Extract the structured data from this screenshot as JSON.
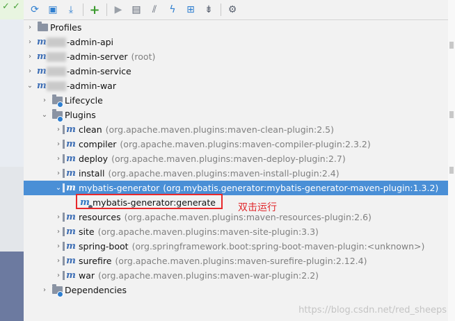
{
  "toolbar": {
    "buttons": [
      {
        "name": "reimport-icon",
        "glyph": "⟳"
      },
      {
        "name": "generate-sources-icon",
        "glyph": "▣"
      },
      {
        "name": "download-icon",
        "glyph": "⤓"
      },
      {
        "name": "add-icon",
        "glyph": "+"
      },
      {
        "name": "run-icon",
        "glyph": "▶"
      },
      {
        "name": "execute-goal-icon",
        "glyph": "▤"
      },
      {
        "name": "toggle-offline-icon",
        "glyph": "⫽"
      },
      {
        "name": "skip-tests-icon",
        "glyph": "ϟ"
      },
      {
        "name": "show-dependencies-icon",
        "glyph": "⊞"
      },
      {
        "name": "collapse-all-icon",
        "glyph": "⇟"
      },
      {
        "name": "settings-icon",
        "glyph": "⚙"
      }
    ]
  },
  "tree": {
    "profiles": "Profiles",
    "modules": [
      {
        "label": "-admin-api",
        "extra": ""
      },
      {
        "label": "-admin-server",
        "extra": "(root)"
      },
      {
        "label": "-admin-service",
        "extra": ""
      },
      {
        "label": "-admin-war",
        "extra": ""
      }
    ],
    "lifecycle": "Lifecycle",
    "plugins": "Plugins",
    "plugin_items": [
      {
        "name": "clean",
        "gav": "(org.apache.maven.plugins:maven-clean-plugin:2.5)"
      },
      {
        "name": "compiler",
        "gav": "(org.apache.maven.plugins:maven-compiler-plugin:2.3.2)"
      },
      {
        "name": "deploy",
        "gav": "(org.apache.maven.plugins:maven-deploy-plugin:2.7)"
      },
      {
        "name": "install",
        "gav": "(org.apache.maven.plugins:maven-install-plugin:2.4)"
      },
      {
        "name": "mybatis-generator",
        "gav": "(org.mybatis.generator:mybatis-generator-maven-plugin:1.3.2)"
      },
      {
        "name": "resources",
        "gav": "(org.apache.maven.plugins:maven-resources-plugin:2.6)"
      },
      {
        "name": "site",
        "gav": "(org.apache.maven.plugins:maven-site-plugin:3.3)"
      },
      {
        "name": "spring-boot",
        "gav": "(org.springframework.boot:spring-boot-maven-plugin:<unknown>)"
      },
      {
        "name": "surefire",
        "gav": "(org.apache.maven.plugins:maven-surefire-plugin:2.12.4)"
      },
      {
        "name": "war",
        "gav": "(org.apache.maven.plugins:maven-war-plugin:2.2)"
      }
    ],
    "goal": "mybatis-generator:generate",
    "dependencies": "Dependencies"
  },
  "annotation": "双击运行",
  "watermark": "https://blog.csdn.net/red_sheeps",
  "colors": {
    "selection": "#4a8fd6",
    "highlight": "#e8282b",
    "annotation": "#e0262a"
  }
}
